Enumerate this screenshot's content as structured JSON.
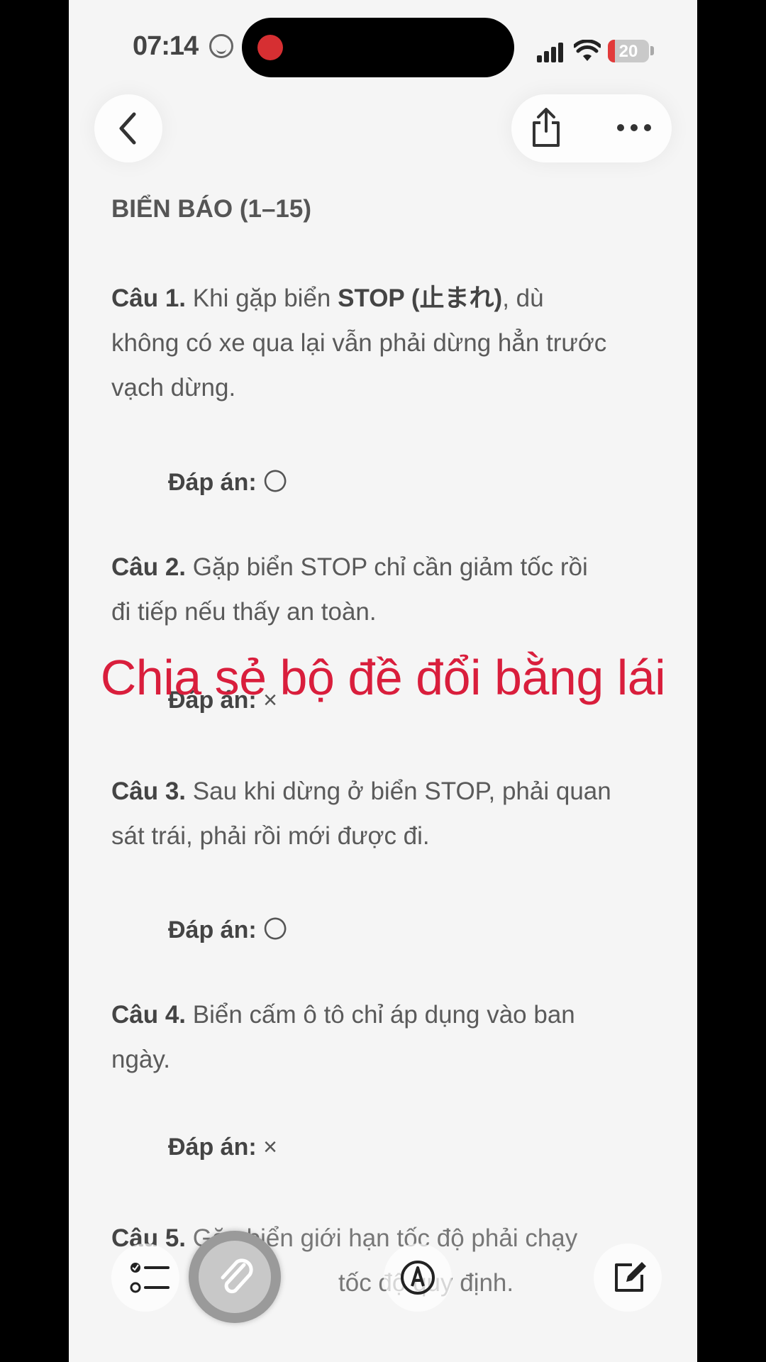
{
  "status_bar": {
    "time": "07:14",
    "battery": "20"
  },
  "section": {
    "title": "BIỂN BÁO (1–15)"
  },
  "questions": [
    {
      "label": "Câu 1.",
      "text_a": " Khi gặp biển ",
      "text_bold": "STOP (止まれ)",
      "text_b": ", dù",
      "line2": "không có xe qua lại vẫn phải dừng hẳn trước",
      "line3": "vạch dừng.",
      "answer_label": "Đáp án:",
      "answer": "〇"
    },
    {
      "label": "Câu 2.",
      "line1": " Gặp biển STOP chỉ cần giảm tốc rồi",
      "line2": "đi tiếp nếu thấy an toàn.",
      "answer_label": "Đáp án:",
      "answer": "×"
    },
    {
      "label": "Câu 3.",
      "line1": " Sau khi dừng ở biển STOP, phải quan",
      "line2": "sát trái, phải rồi mới được đi.",
      "answer_label": "Đáp án:",
      "answer": "〇"
    },
    {
      "label": "Câu 4.",
      "line1": " Biển cấm ô tô chỉ áp dụng vào ban",
      "line2": "ngày.",
      "answer_label": "Đáp án:",
      "answer": "×"
    },
    {
      "label": "Câu 5.",
      "line1": " Gặp biển giới hạn tốc độ phải chạy",
      "line2": "tốc độ quy định."
    }
  ],
  "overlay": {
    "caption": "Chia sẻ bộ đề đổi bằng lái"
  },
  "icons": {
    "back": "chevron-left-icon",
    "share": "share-icon",
    "more": "more-icon",
    "checklist": "checklist-icon",
    "attach": "paperclip-icon",
    "markup": "markup-pen-icon",
    "compose": "compose-icon"
  },
  "colors": {
    "caption": "#d91e3c",
    "record": "#d62f32",
    "battery_low": "#e23b3b"
  }
}
